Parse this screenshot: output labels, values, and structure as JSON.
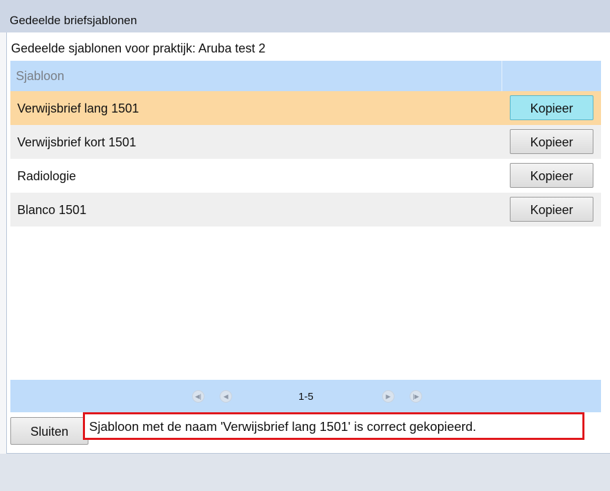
{
  "window": {
    "title": "Gedeelde briefsjablonen"
  },
  "subtitle": "Gedeelde sjablonen voor praktijk: Aruba test 2",
  "grid": {
    "columns": [
      "Sjabloon",
      ""
    ],
    "rows": [
      {
        "name": "Verwijsbrief lang 1501",
        "action": "Kopieer",
        "state": "selected"
      },
      {
        "name": "Verwijsbrief kort 1501",
        "action": "Kopieer",
        "state": "normal"
      },
      {
        "name": "Radiologie",
        "action": "Kopieer",
        "state": "normal"
      },
      {
        "name": "Blanco 1501",
        "action": "Kopieer",
        "state": "normal"
      }
    ]
  },
  "pager": {
    "range": "1-5",
    "icons": [
      "first-page-icon",
      "prev-page-icon",
      "next-page-icon",
      "last-page-icon"
    ]
  },
  "close_button": "Sluiten",
  "message": "Sjabloon met de naam 'Verwijsbrief lang 1501' is correct gekopieerd.",
  "colors": {
    "selected_row": "#fcd8a1",
    "header": "#bfdcfa",
    "selected_button": "#9fe6f2",
    "message_border": "#e0161b"
  }
}
